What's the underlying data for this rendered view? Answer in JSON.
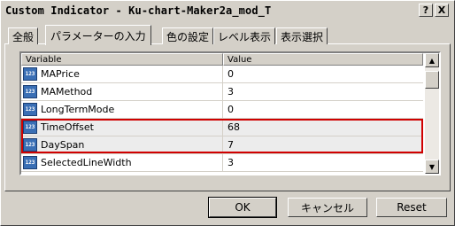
{
  "window": {
    "title": "Custom Indicator - Ku-chart-Maker2a_mod_T",
    "help_label": "?",
    "close_label": "X"
  },
  "tabs": [
    {
      "label": "全般"
    },
    {
      "label": "パラメーターの入力",
      "active": true
    },
    {
      "label": "色の設定"
    },
    {
      "label": "レベル表示"
    },
    {
      "label": "表示選択"
    }
  ],
  "grid": {
    "columns": [
      "Variable",
      "Value"
    ],
    "icon_text": "123",
    "rows": [
      {
        "variable": "MAPrice",
        "value": "0"
      },
      {
        "variable": "MAMethod",
        "value": "3"
      },
      {
        "variable": "LongTermMode",
        "value": "0"
      },
      {
        "variable": "TimeOffset",
        "value": "68"
      },
      {
        "variable": "DaySpan",
        "value": "7"
      },
      {
        "variable": "SelectedLineWidth",
        "value": "3"
      }
    ],
    "scroll_up": "▲",
    "scroll_down": "▼"
  },
  "buttons": {
    "ok": "OK",
    "cancel": "キャンセル",
    "reset": "Reset"
  },
  "colors": {
    "highlight": "#d00000",
    "icon_bg": "#3a6fb5"
  }
}
